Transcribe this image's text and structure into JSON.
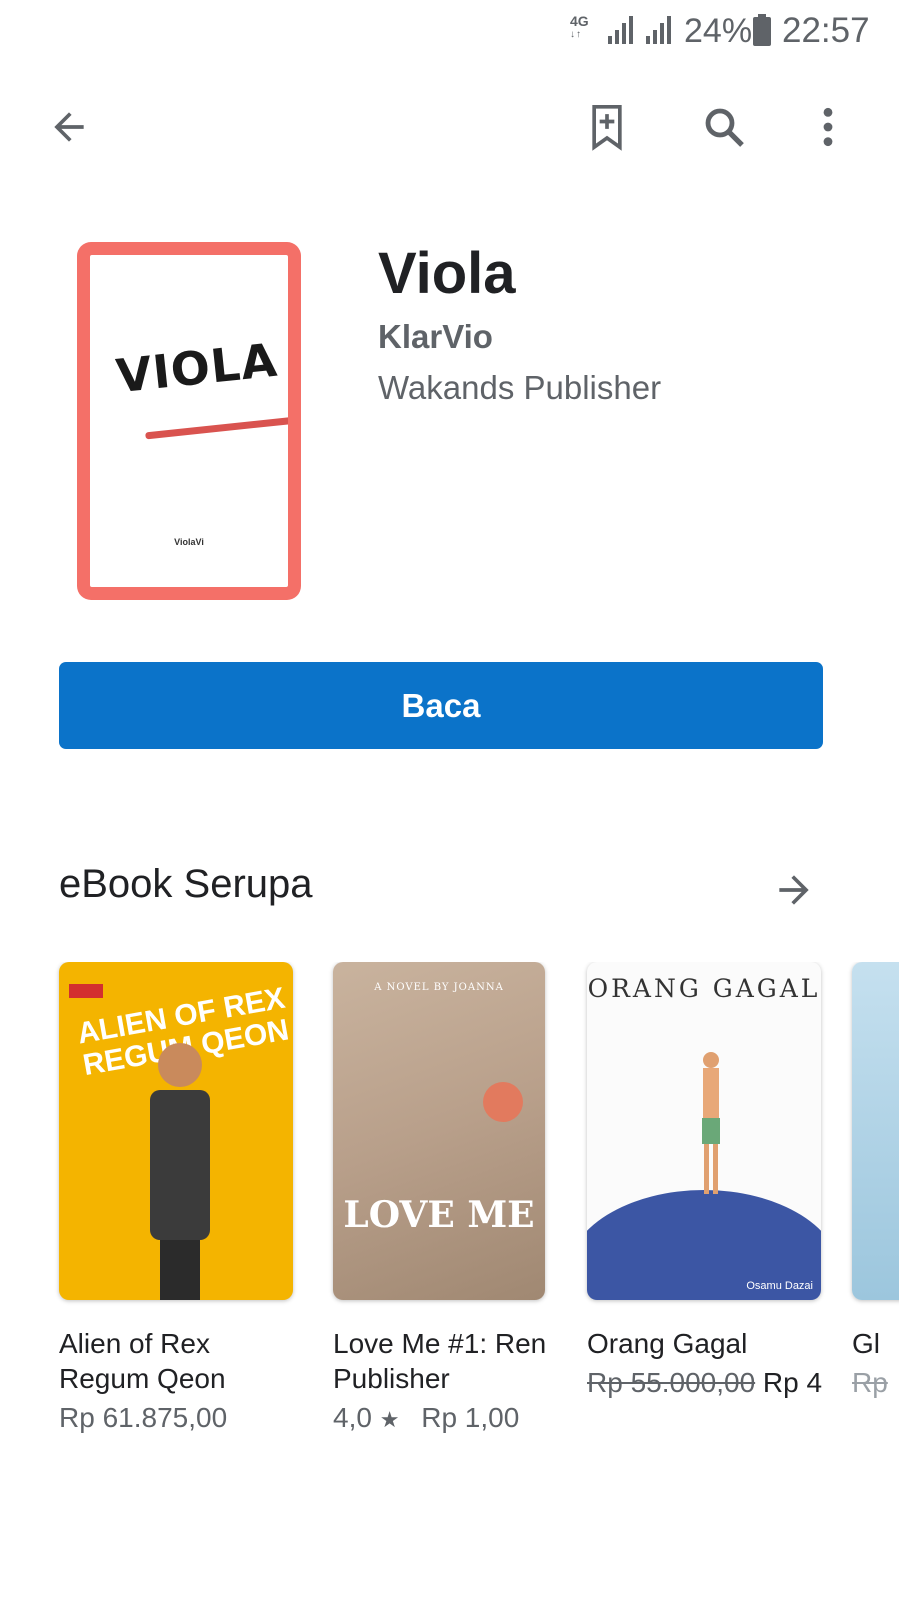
{
  "status_bar": {
    "network": "4G",
    "battery_percent": "24%",
    "time": "22:57"
  },
  "toolbar": {
    "back_icon": "arrow-back-icon",
    "wishlist_icon": "bookmark-add-icon",
    "search_icon": "search-icon",
    "more_icon": "more-vert-icon"
  },
  "book": {
    "cover_title": "VIOLA",
    "cover_author": "ViolaVi",
    "title": "Viola",
    "author": "KlarVio",
    "publisher": "Wakands Publisher",
    "cover_color": "#f47068"
  },
  "read_button": {
    "label": "Baca",
    "color": "#0b73c9"
  },
  "similar": {
    "heading": "eBook Serupa",
    "items": [
      {
        "cover_text": "ALIEN OF REX REGUM QEON",
        "title_line1": "Alien of Rex",
        "title_line2": "Regum Qeon",
        "price": "Rp 61.875,00"
      },
      {
        "cover_header": "A NOVEL BY JOANNA",
        "cover_text": "LOVE ME",
        "title_line1": "Love Me #1: Ren",
        "title_line2": "Publisher",
        "rating": "4,0",
        "price": "Rp 1,00"
      },
      {
        "cover_text": "ORANG GAGAL",
        "cover_author": "Osamu Dazai",
        "title_line1": "Orang Gagal",
        "old_price": "Rp 55.000,00",
        "price": "Rp 4"
      },
      {
        "title_line1": "Gl",
        "old_price": "Rp"
      }
    ]
  }
}
